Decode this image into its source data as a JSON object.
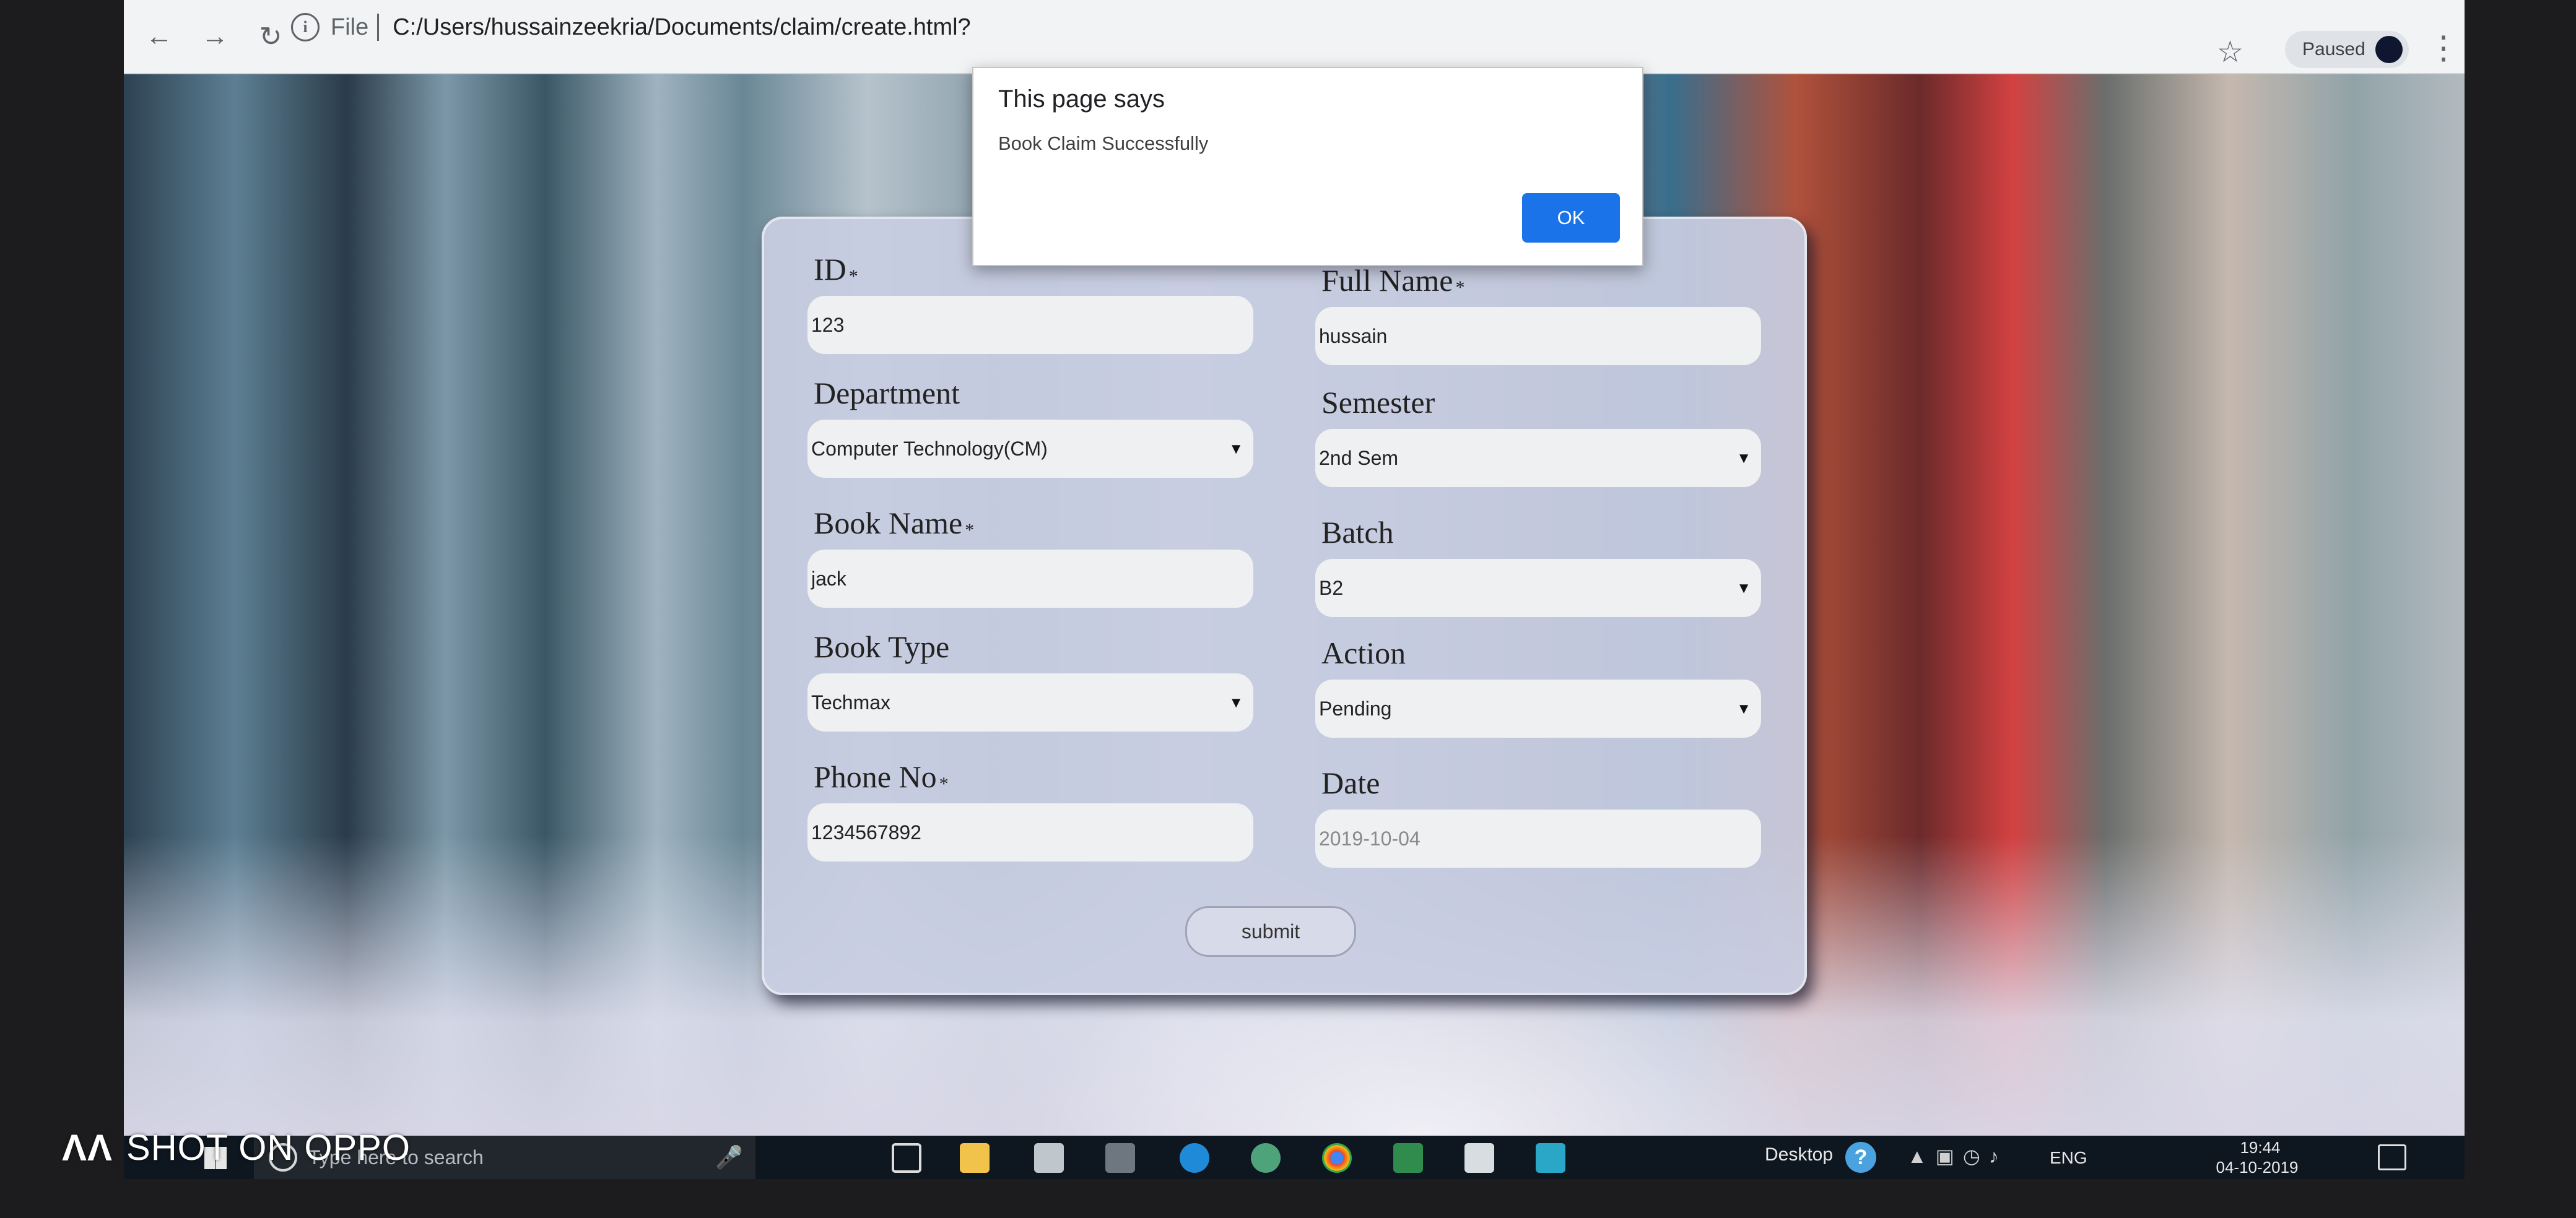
{
  "browser": {
    "scheme": "File",
    "url": "C:/Users/hussainzeekria/Documents/claim/create.html?",
    "profile_status": "Paused"
  },
  "dialog": {
    "title": "This page says",
    "message": "Book Claim Successfully",
    "ok_label": "OK"
  },
  "form": {
    "id": {
      "label": "ID",
      "required": "*",
      "value": "123"
    },
    "full_name": {
      "label": "Full Name",
      "required": "*",
      "value": "hussain"
    },
    "department": {
      "label": "Department",
      "value": "Computer Technology(CM)"
    },
    "semester": {
      "label": "Semester",
      "value": "2nd Sem"
    },
    "book_name": {
      "label": "Book Name",
      "required": "*",
      "value": "jack"
    },
    "batch": {
      "label": "Batch",
      "value": "B2"
    },
    "book_type": {
      "label": "Book Type",
      "value": "Techmax"
    },
    "action": {
      "label": "Action",
      "value": "Pending"
    },
    "phone": {
      "label": "Phone No",
      "required": "*",
      "value": "1234567892"
    },
    "date": {
      "label": "Date",
      "placeholder": "2019-10-04"
    },
    "submit_label": "submit"
  },
  "taskbar": {
    "search_placeholder": "Type here to search",
    "desktop_label": "Desktop",
    "language": "ENG",
    "time": "19:44",
    "date": "04-10-2019"
  },
  "watermark": {
    "text": "SHOT ON OPPO"
  }
}
